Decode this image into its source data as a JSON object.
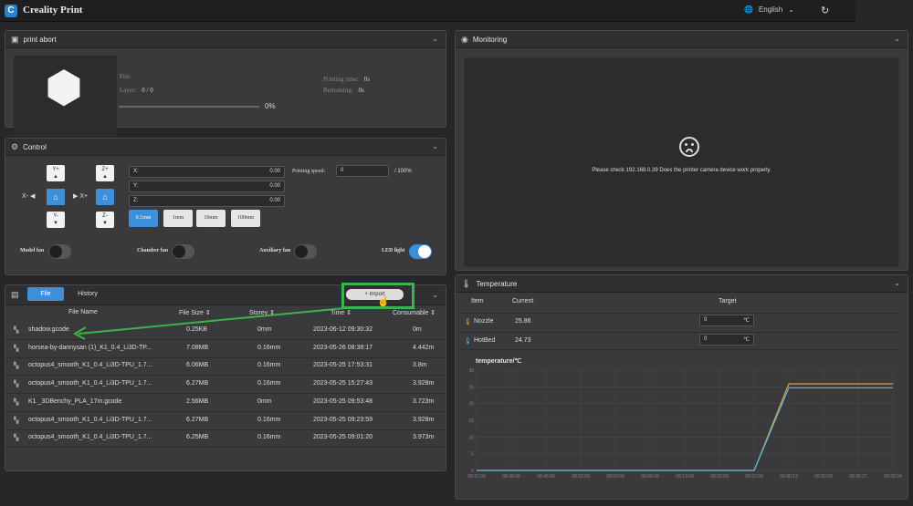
{
  "app": {
    "title": "Creality Print",
    "language": "English"
  },
  "print_panel": {
    "title": "print abort",
    "file_label": "File:",
    "layer_label": "Layer:",
    "layer_value": "0 / 0",
    "printing_time_label": "Printing time:",
    "printing_time_value": "0s",
    "remaining_label": "Remaining:",
    "remaining_value": "0s",
    "progress_text": "0%",
    "progress_fraction": 0
  },
  "control": {
    "title": "Control",
    "jog": {
      "y_plus": "Y+",
      "y_minus": "Y-",
      "x_minus": "X-",
      "x_plus": "X+",
      "z_plus": "Z+",
      "z_minus": "Z-"
    },
    "axes": [
      {
        "label": "X:",
        "value": "0.00"
      },
      {
        "label": "Y:",
        "value": "0.00"
      },
      {
        "label": "Z:",
        "value": "0.00"
      }
    ],
    "speed_label": "Printing speed:",
    "speed_value": "0",
    "speed_suffix": "/ 100%",
    "steps": [
      "0.1mm",
      "1mm",
      "10mm",
      "100mm"
    ],
    "fans": [
      {
        "label": "Model fan",
        "on": false
      },
      {
        "label": "Chamber fan",
        "on": false
      },
      {
        "label": "Auxiliary fan",
        "on": false
      },
      {
        "label": "LED light",
        "on": true
      }
    ]
  },
  "files": {
    "tabs": [
      "File",
      "History"
    ],
    "import_label": "Import",
    "columns": [
      "File Name",
      "File Size",
      "Storey",
      "Time",
      "Consumable"
    ],
    "rows": [
      {
        "name": "shadow.gcode",
        "size": "0.25KB",
        "storey": "0mm",
        "time": "2023-06-12 09:30:32",
        "consumable": "0m"
      },
      {
        "name": "horsea-by-dannysan (1)_K1_0.4_Li3D-TP...",
        "size": "7.08MB",
        "storey": "0.16mm",
        "time": "2023-05-26 08:38:17",
        "consumable": "4.442m"
      },
      {
        "name": "octopus4_smooth_K1_0.4_Li3D-TPU_1.7...",
        "size": "6.06MB",
        "storey": "0.16mm",
        "time": "2023-05-25 17:53:31",
        "consumable": "3.8m"
      },
      {
        "name": "octopus4_smooth_K1_0.4_Li3D-TPU_1.7...",
        "size": "6.27MB",
        "storey": "0.16mm",
        "time": "2023-05-25 15:27:43",
        "consumable": "3.928m"
      },
      {
        "name": "K1 _3DBenchy_PLA_17m.gcode",
        "size": "2.56MB",
        "storey": "0mm",
        "time": "2023-05-25 09:53:48",
        "consumable": "3.723m"
      },
      {
        "name": "octopus4_smooth_K1_0.4_Li3D-TPU_1.7...",
        "size": "6.27MB",
        "storey": "0.16mm",
        "time": "2023-05-25 09:23:59",
        "consumable": "3.928m"
      },
      {
        "name": "octopus4_smooth_K1_0.4_Li3D-TPU_1.7...",
        "size": "6.25MB",
        "storey": "0.16mm",
        "time": "2023-05-25 09:01:20",
        "consumable": "3.973m"
      }
    ]
  },
  "monitoring": {
    "title": "Monitoring",
    "message": "Please check 192.168.0.39 Does the printer camera device work properly."
  },
  "temperature": {
    "title": "Temperature",
    "columns": [
      "Item",
      "Current",
      "Target"
    ],
    "rows": [
      {
        "name": "Nozzle",
        "current": "25.86",
        "target": "0",
        "unit": "℃"
      },
      {
        "name": "HotBed",
        "current": "24.73",
        "target": "0",
        "unit": "℃"
      }
    ]
  },
  "chart_data": {
    "type": "line",
    "title": "temperature/℃",
    "ylim": [
      0,
      30
    ],
    "yticks": [
      "0",
      "5",
      "10",
      "15",
      "20",
      "25",
      "30"
    ],
    "categories": [
      "08:31:09",
      "08:38:09",
      "08:45:09",
      "08:52:09",
      "08:59:09",
      "09:06:09",
      "09:13:09",
      "09:20:09",
      "09:27:09",
      "09:30:13",
      "09:30:20",
      "09:30:27",
      "09:30:34"
    ],
    "series": [
      {
        "color": "#e0a23b",
        "values": [
          0,
          0,
          0,
          0,
          0,
          0,
          0,
          0,
          0,
          25.9,
          25.9,
          25.9,
          25.9
        ]
      },
      {
        "color": "#5ab4d8",
        "values": [
          0,
          0,
          0,
          0,
          0,
          0,
          0,
          0,
          0,
          24.7,
          24.7,
          24.7,
          24.7
        ]
      }
    ],
    "grid": true
  },
  "colors": {
    "accent": "#3d8fd9",
    "highlight": "#3cb34a"
  }
}
